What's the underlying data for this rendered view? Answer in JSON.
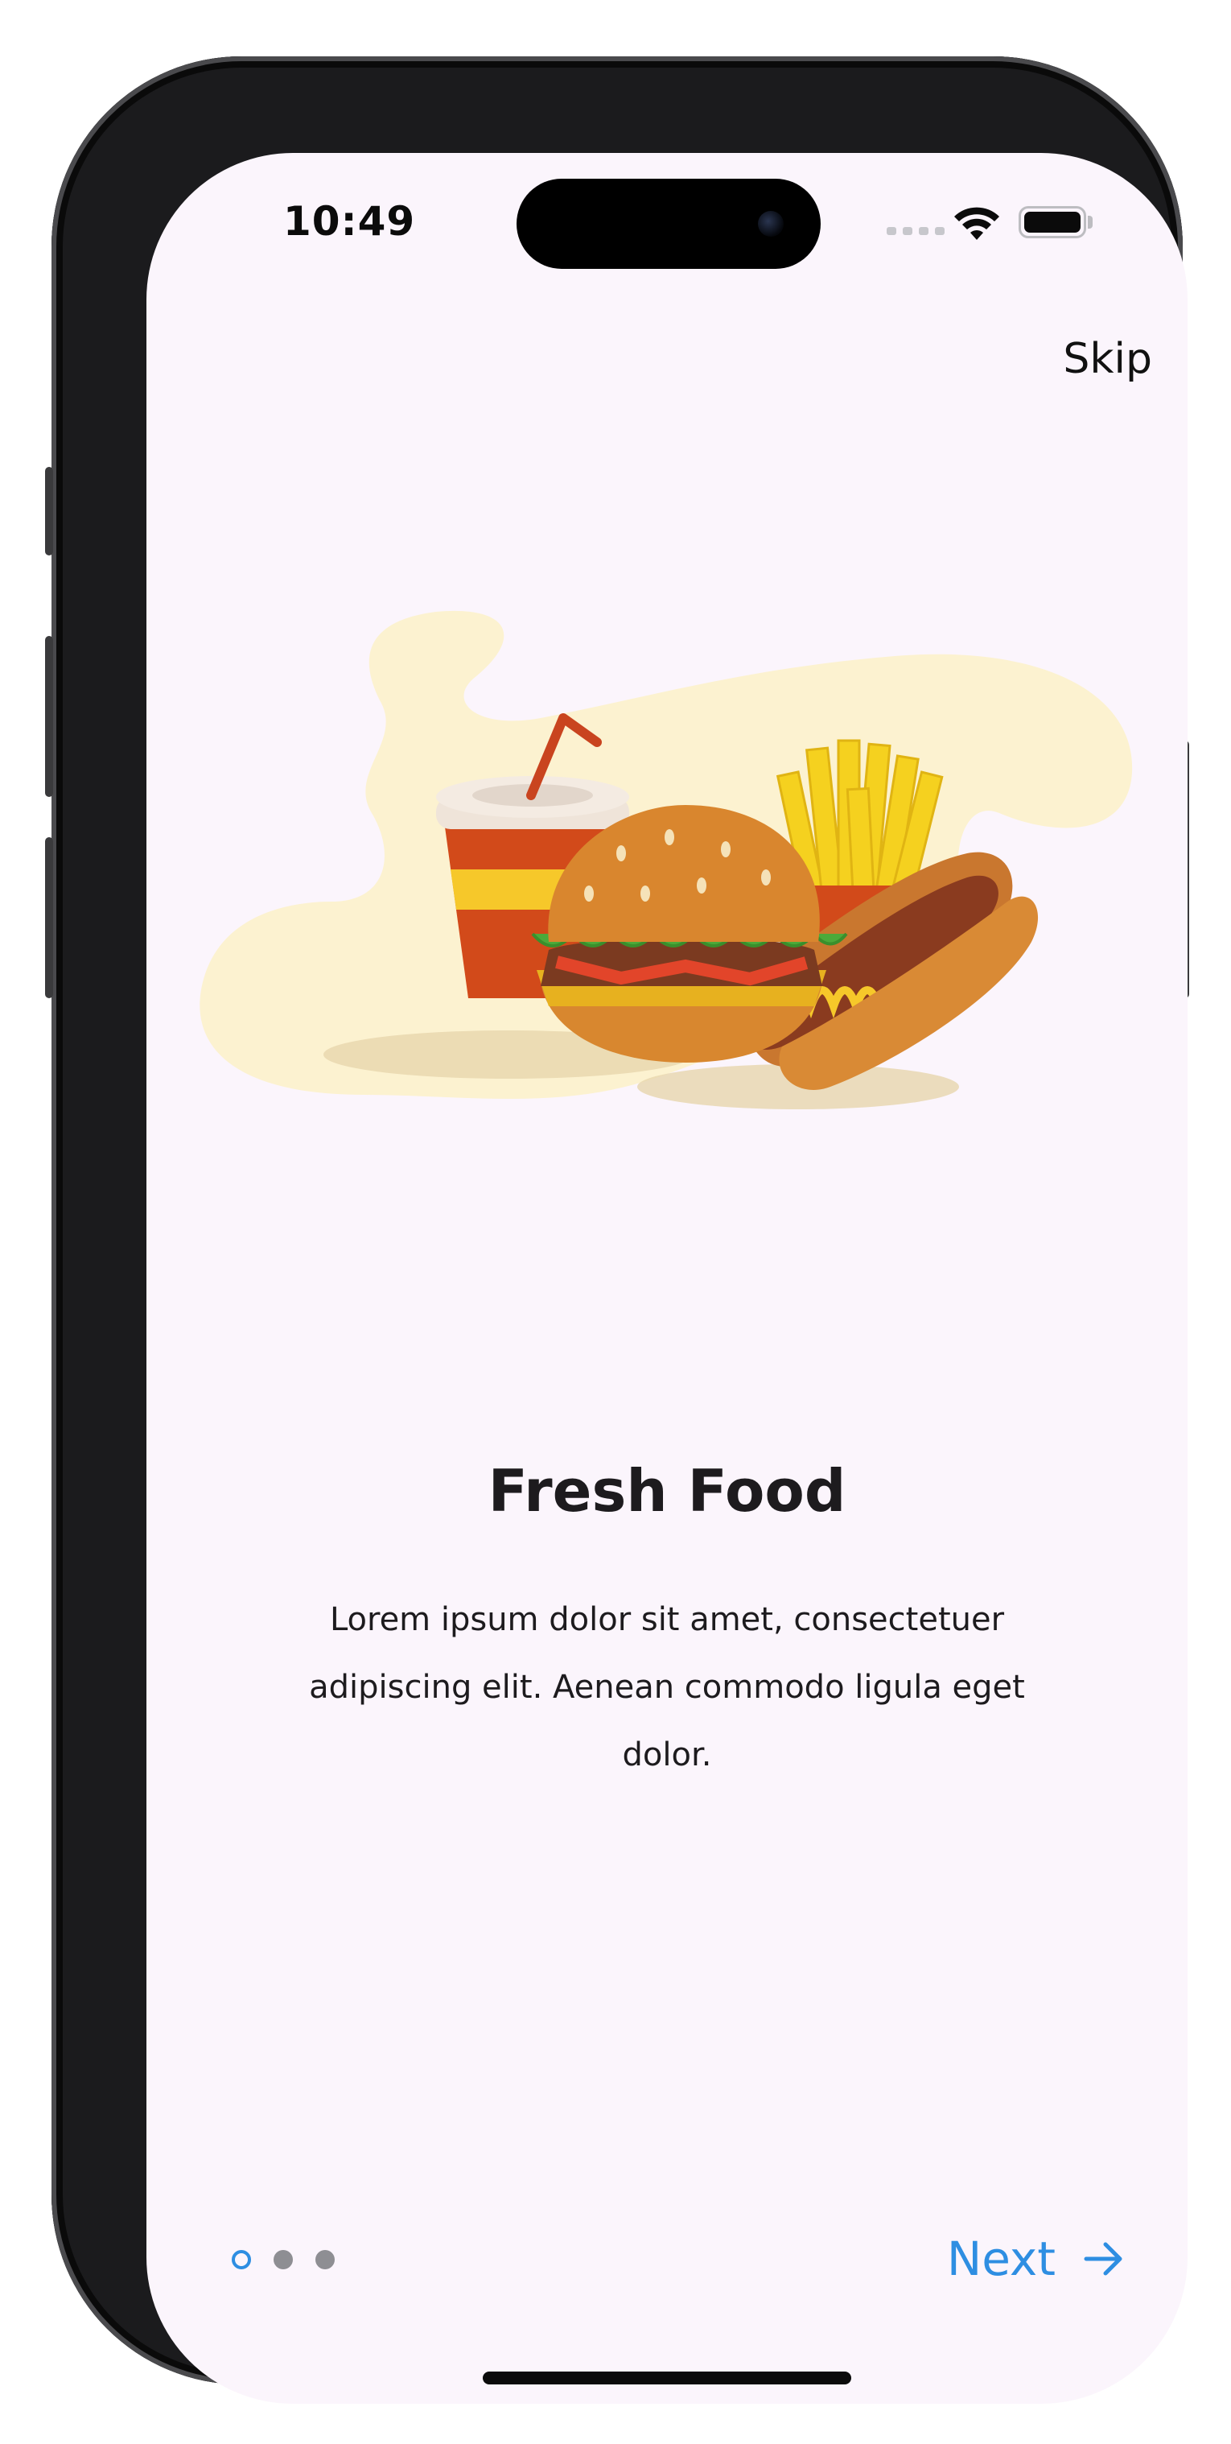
{
  "status_bar": {
    "time": "10:49"
  },
  "top_bar": {
    "skip_label": "Skip"
  },
  "onboarding": {
    "title": "Fresh Food",
    "description": "Lorem ipsum dolor sit amet, consectetuer adipiscing elit. Aenean commodo ligula eget dolor."
  },
  "pager": {
    "current_page": 1,
    "total_pages": 3
  },
  "footer": {
    "next_label": "Next"
  },
  "icons": {
    "wifi": "wifi-icon",
    "battery": "battery-icon",
    "next_arrow": "arrow-right-icon"
  },
  "colors": {
    "accent": "#2E8EE2",
    "background": "#FBF5FC",
    "blob": "#FCF2D0",
    "text": "#1D1B1E"
  }
}
